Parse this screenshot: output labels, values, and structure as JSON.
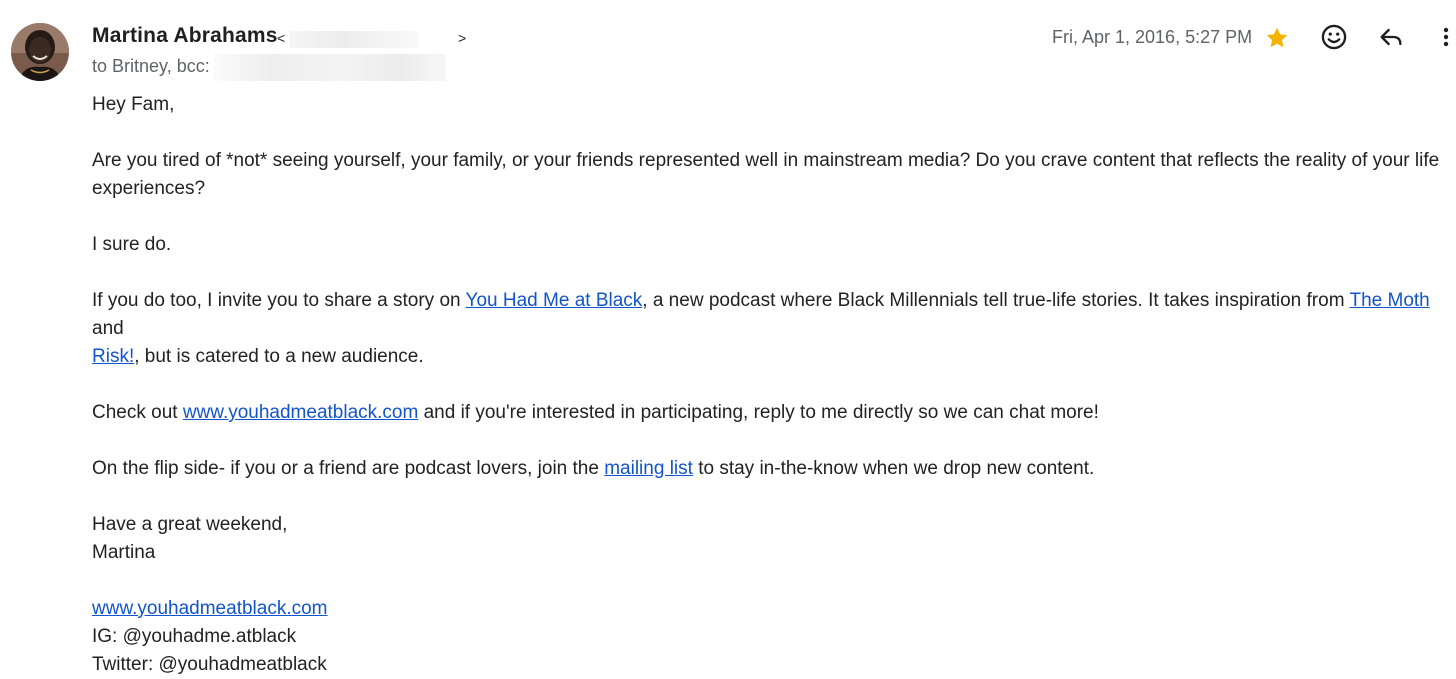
{
  "sender": {
    "name": "Martina Abrahams",
    "email_open": "<",
    "email_close": ">"
  },
  "recipients": "to Britney, bcc:",
  "date": "Fri, Apr 1, 2016, 5:27 PM",
  "icons": {
    "avatar": "avatar",
    "star": "star-icon",
    "emoji": "emoji-reaction-icon",
    "reply": "reply-icon",
    "more": "more-vert-icon"
  },
  "colors": {
    "star": "#f4b400",
    "link": "#1155cc",
    "meta_text": "#5f6368",
    "body_text": "#222222"
  },
  "body": {
    "greeting": "Hey Fam,",
    "p1": "Are you tired of *not* seeing yourself, your family, or your friends represented well in mainstream media? Do you crave content that reflects the reality of your life experiences?",
    "p2": "I sure do.",
    "p3_a": "If you do too, I invite you to share a story on ",
    "p3_link1": "You Had Me at Black",
    "p3_b": ", a new podcast where Black Millennials tell true-life stories. It takes inspiration from ",
    "p3_link2": "The Moth",
    "p3_c": " and ",
    "p3_link3": "Risk!",
    "p3_d": ", but is catered to a new audience.",
    "p4_a": "Check out ",
    "p4_link": "www.youhadmeatblack.com",
    "p4_b": " and if you're interested in participating, reply to me directly so we can chat more!",
    "p5_a": "On the flip side- if you or a friend are podcast lovers, join the ",
    "p5_link": "mailing list",
    "p5_b": " to stay in-the-know when we drop new content.",
    "closing": "Have a great weekend,",
    "signoff": "Martina",
    "sig_link": "www.youhadmeatblack.com",
    "sig_ig": "IG: @youhadme.atblack",
    "sig_twitter": "Twitter: @youhadmeatblack"
  }
}
